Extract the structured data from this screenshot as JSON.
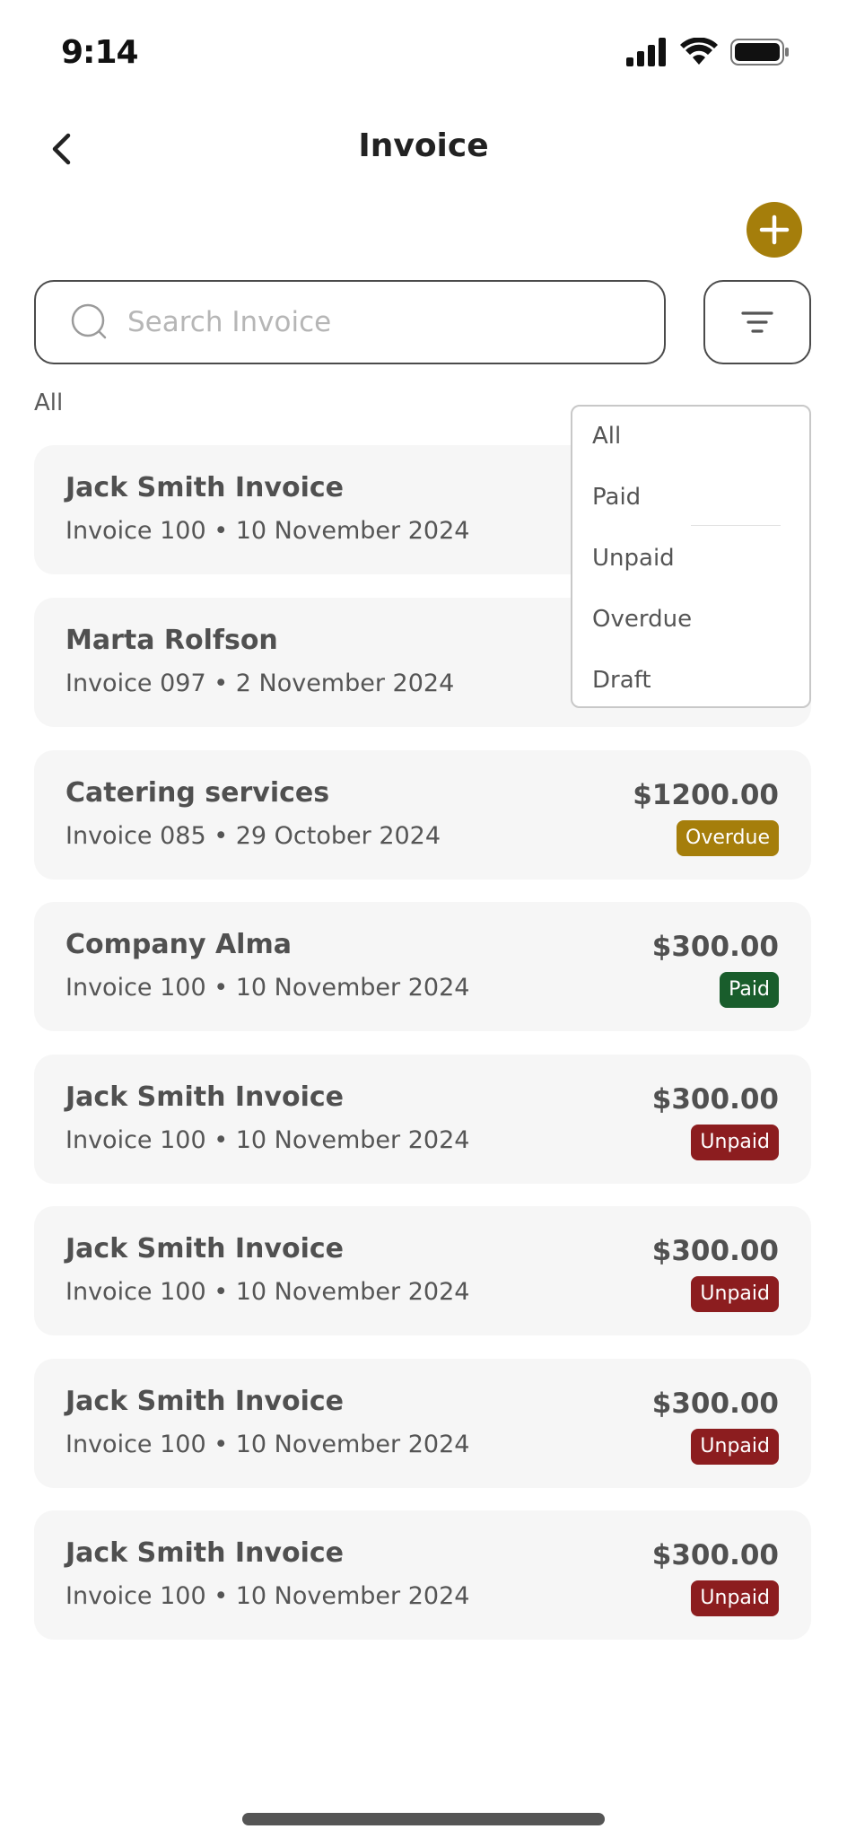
{
  "status_bar": {
    "time": "9:14"
  },
  "header": {
    "title": "Invoice"
  },
  "search": {
    "placeholder": "Search Invoice"
  },
  "filter": {
    "current": "All"
  },
  "dropdown": {
    "options": [
      "All",
      "Paid",
      "Unpaid",
      "Overdue",
      "Draft"
    ]
  },
  "invoices": [
    {
      "name": "Jack Smith Invoice",
      "meta": "Invoice 100 • 10 November 2024"
    },
    {
      "name": "Marta Rolfson",
      "meta": "Invoice 097 • 2 November 2024"
    },
    {
      "name": "Catering services",
      "meta": "Invoice 085 • 29 October 2024",
      "amount": "$1200.00",
      "status": "Overdue"
    },
    {
      "name": "Company Alma",
      "meta": "Invoice 100 • 10 November 2024",
      "amount": "$300.00",
      "status": "Paid"
    },
    {
      "name": "Jack Smith Invoice",
      "meta": "Invoice 100 • 10 November 2024",
      "amount": "$300.00",
      "status": "Unpaid"
    },
    {
      "name": "Jack Smith Invoice",
      "meta": "Invoice 100 • 10 November 2024",
      "amount": "$300.00",
      "status": "Unpaid"
    },
    {
      "name": "Jack Smith Invoice",
      "meta": "Invoice 100 • 10 November 2024",
      "amount": "$300.00",
      "status": "Unpaid"
    },
    {
      "name": "Jack Smith Invoice",
      "meta": "Invoice 100 • 10 November 2024",
      "amount": "$300.00",
      "status": "Unpaid"
    }
  ],
  "colors": {
    "accent": "#a57e0b",
    "overdue": "#a57e0b",
    "paid": "#195d2c",
    "unpaid": "#8c1d1f",
    "card_bg": "#f6f6f6"
  },
  "icons": {
    "back": "chevron-left-icon",
    "add": "plus-icon",
    "search": "search-icon",
    "filter": "filter-icon"
  }
}
